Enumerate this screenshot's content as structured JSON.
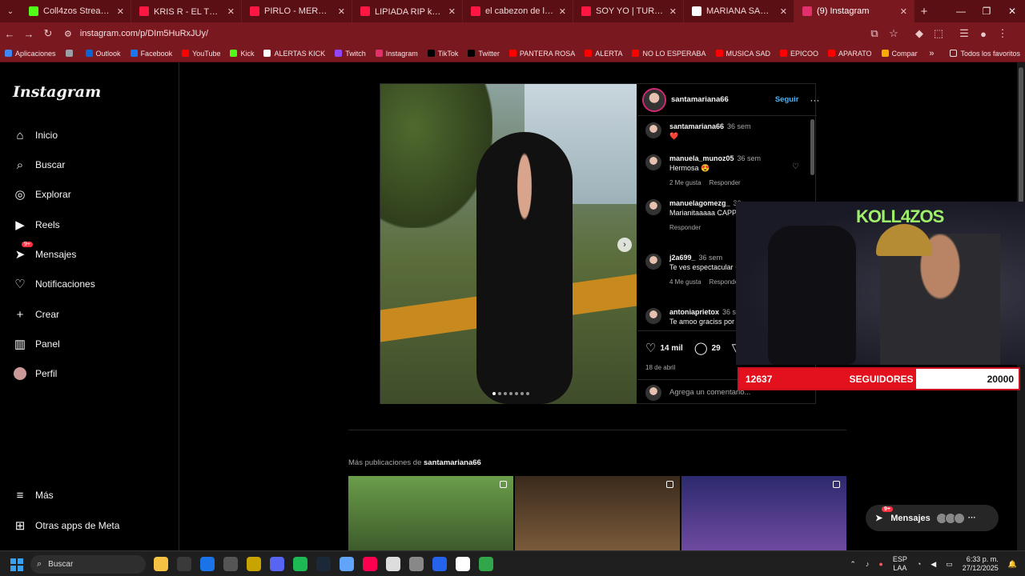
{
  "tabs": [
    {
      "title": "Coll4zos Stream - Watch Live",
      "color": "#53fc18",
      "active": false
    },
    {
      "title": "KRIS R - EL TESTIGO 🎄 (Vid",
      "color": "#ff1744",
      "active": false
    },
    {
      "title": "PIRLO - MERRY CHRISTMAS",
      "color": "#ff1744",
      "active": false
    },
    {
      "title": "LIPIADA RIP kk 🚴 🏕 @EL",
      "color": "#ff1744",
      "active": false
    },
    {
      "title": "el cabezon de los cantores",
      "color": "#ff1744",
      "active": false
    },
    {
      "title": "SOY YO | TURY ( Video Oficial",
      "color": "#ff1744",
      "active": false
    },
    {
      "title": "MARIANA SANTRA - Buscar",
      "color": "#ffffff",
      "active": false
    },
    {
      "title": "(9) Instagram",
      "color": "#e1306c",
      "active": true
    }
  ],
  "new_tab": "+",
  "window_controls": {
    "minimize": "—",
    "maximize": "❐",
    "close": "✕"
  },
  "url": "instagram.com/p/DIm5HuRxJUy/",
  "bookmarks": [
    {
      "label": "Aplicaciones",
      "color": "#4285f4"
    },
    {
      "label": "",
      "color": "#9aa0a6"
    },
    {
      "label": "Outlook",
      "color": "#0a64d6"
    },
    {
      "label": "Facebook",
      "color": "#1877f2"
    },
    {
      "label": "YouTube",
      "color": "#ff0000"
    },
    {
      "label": "Kick",
      "color": "#53fc18"
    },
    {
      "label": "ALERTAS KICK",
      "color": "#ffffff"
    },
    {
      "label": "Twitch",
      "color": "#9146ff"
    },
    {
      "label": "Instagram",
      "color": "#e1306c"
    },
    {
      "label": "TikTok",
      "color": "#000000"
    },
    {
      "label": "Twitter",
      "color": "#000000"
    },
    {
      "label": "PANTERA ROSA",
      "color": "#ff0000"
    },
    {
      "label": "ALERTA",
      "color": "#ff0000"
    },
    {
      "label": "NO LO ESPERABA",
      "color": "#ff0000"
    },
    {
      "label": "MUSICA SAD",
      "color": "#ff0000"
    },
    {
      "label": "EPICOO",
      "color": "#ff0000"
    },
    {
      "label": "APARATO",
      "color": "#ff0000"
    },
    {
      "label": "Compartir vía Wi-Fi",
      "color": "#f9ab00"
    }
  ],
  "bookmarks_overflow": "»",
  "bookmarks_all": "Todos los favoritos",
  "sidebar": {
    "logo": "Instagram",
    "items": [
      {
        "label": "Inicio",
        "icon": "⌂"
      },
      {
        "label": "Buscar",
        "icon": "⌕"
      },
      {
        "label": "Explorar",
        "icon": "◎"
      },
      {
        "label": "Reels",
        "icon": "▶"
      },
      {
        "label": "Mensajes",
        "icon": "➤"
      },
      {
        "label": "Notificaciones",
        "icon": "♡"
      },
      {
        "label": "Crear",
        "icon": "+"
      },
      {
        "label": "Panel",
        "icon": "▥"
      },
      {
        "label": "Perfil",
        "icon": ""
      }
    ],
    "messages_badge": "9+",
    "bottom": [
      {
        "label": "Más",
        "icon": "≡"
      },
      {
        "label": "Otras apps de Meta",
        "icon": "⊞"
      }
    ]
  },
  "post": {
    "author": "santamariana66",
    "follow_label": "Seguir",
    "more": "···",
    "next_arrow": "›",
    "carousel_dots": 7,
    "comments": [
      {
        "user": "santamariana66",
        "time": "36 sem",
        "text": "❤️",
        "meta": []
      },
      {
        "user": "manuela_munoz05",
        "time": "36 sem",
        "text": "Hermosa 😍",
        "meta": [
          "2 Me gusta",
          "Responder"
        ]
      },
      {
        "user": "manuelagomezg_",
        "time": "36 sem",
        "text": "Marianitaaaaa CAPPUCINAAAA✨",
        "meta": [
          "Responder"
        ]
      },
      {
        "user": "j2a699_",
        "time": "36 sem",
        "text": "Te ves espectacular 😍😍",
        "meta": [
          "4 Me gusta",
          "Responder"
        ]
      },
      {
        "user": "antoniaprietox",
        "time": "36 sem",
        "text": "Te amoo graciss por",
        "meta": []
      }
    ],
    "likes": "14 mil",
    "comments_count": "29",
    "date": "18 de abril",
    "add_comment_placeholder": "Agrega un comentario..."
  },
  "more_posts": {
    "prefix": "Más publicaciones de",
    "user": "santamariana66"
  },
  "messages_pill": {
    "label": "Mensajes",
    "badge": "9+",
    "more": "···"
  },
  "cam": {
    "neon_sign": "KOLL4ZOS"
  },
  "follower_counter": {
    "current": "12637",
    "label": "SEGUIDORES",
    "goal": "20000",
    "progress": 0.632
  },
  "taskbar": {
    "search_placeholder": "Buscar",
    "tray_lang_1": "ESP",
    "tray_lang_2": "LAA",
    "time": "6:33 p. m.",
    "date": "27/12/2025",
    "icons": [
      "#f5c242",
      "#3a3a3a",
      "#1a73e8",
      "#555555",
      "#c8a400",
      "#5865f2",
      "#1db954",
      "#1b2838",
      "#60a5fa",
      "#ff0050",
      "#dddddd",
      "#888888",
      "#2563eb",
      "#ffffff",
      "#31a64a"
    ]
  }
}
